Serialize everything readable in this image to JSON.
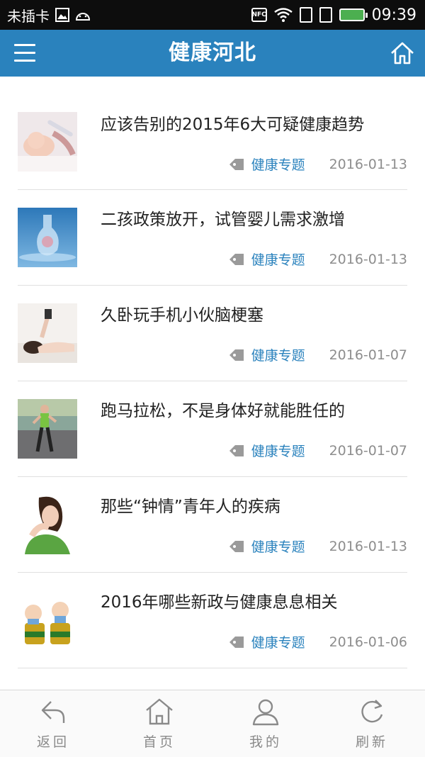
{
  "status_bar": {
    "carrier": "未插卡",
    "nfc": "NFC",
    "time": "09:39"
  },
  "header": {
    "title": "健康河北"
  },
  "articles": [
    {
      "title": "应该告别的2015年6大可疑健康趋势",
      "category": "健康专题",
      "date": "2016-01-13",
      "thumb": "baby-injection"
    },
    {
      "title": "二孩政策放开，试管婴儿需求激增",
      "category": "健康专题",
      "date": "2016-01-13",
      "thumb": "test-tube"
    },
    {
      "title": "久卧玩手机小伙脑梗塞",
      "category": "健康专题",
      "date": "2016-01-07",
      "thumb": "woman-lying-phone"
    },
    {
      "title": "跑马拉松，不是身体好就能胜任的",
      "category": "健康专题",
      "date": "2016-01-07",
      "thumb": "runner"
    },
    {
      "title": "那些“钟情”青年人的疾病",
      "category": "健康专题",
      "date": "2016-01-13",
      "thumb": "woman-neck-pain"
    },
    {
      "title": "2016年哪些新政与健康息息相关",
      "category": "健康专题",
      "date": "2016-01-06",
      "thumb": "cartoon-babies"
    }
  ],
  "bottom_nav": {
    "back": "返回",
    "home": "首页",
    "mine": "我的",
    "refresh": "刷新"
  }
}
